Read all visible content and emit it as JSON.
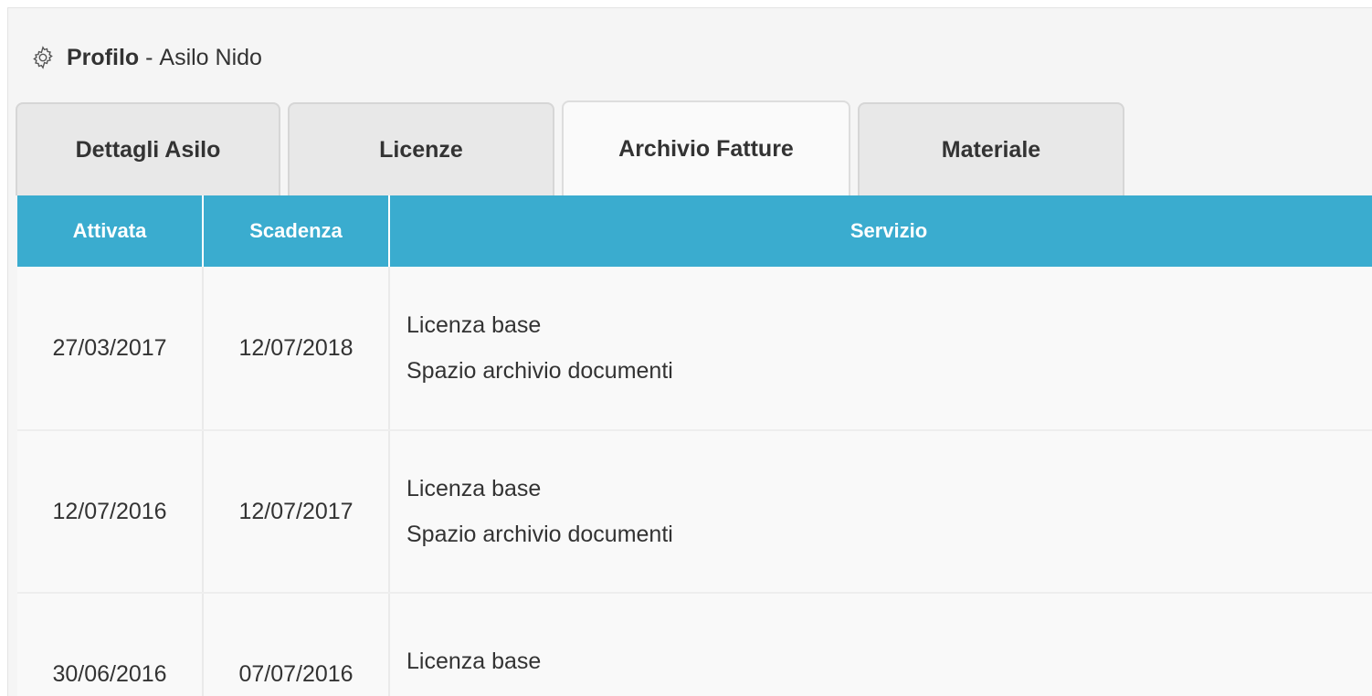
{
  "header": {
    "title": "Profilo",
    "separator": " - ",
    "subtitle": "Asilo Nido",
    "icon": "gear-icon"
  },
  "tabs": [
    {
      "label": "Dettagli Asilo",
      "active": false
    },
    {
      "label": "Licenze",
      "active": false
    },
    {
      "label": "Archivio Fatture",
      "active": true
    },
    {
      "label": "Materiale",
      "active": false
    }
  ],
  "table": {
    "columns": [
      "Attivata",
      "Scadenza",
      "Servizio"
    ],
    "header_color": "#3aaccf",
    "rows": [
      {
        "attivata": "27/03/2017",
        "scadenza": "12/07/2018",
        "servizio": [
          "Licenza base",
          "Spazio archivio documenti"
        ]
      },
      {
        "attivata": "12/07/2016",
        "scadenza": "12/07/2017",
        "servizio": [
          "Licenza base",
          "Spazio archivio documenti"
        ]
      },
      {
        "attivata": "30/06/2016",
        "scadenza": "07/07/2016",
        "servizio": [
          "Licenza base"
        ]
      }
    ]
  }
}
